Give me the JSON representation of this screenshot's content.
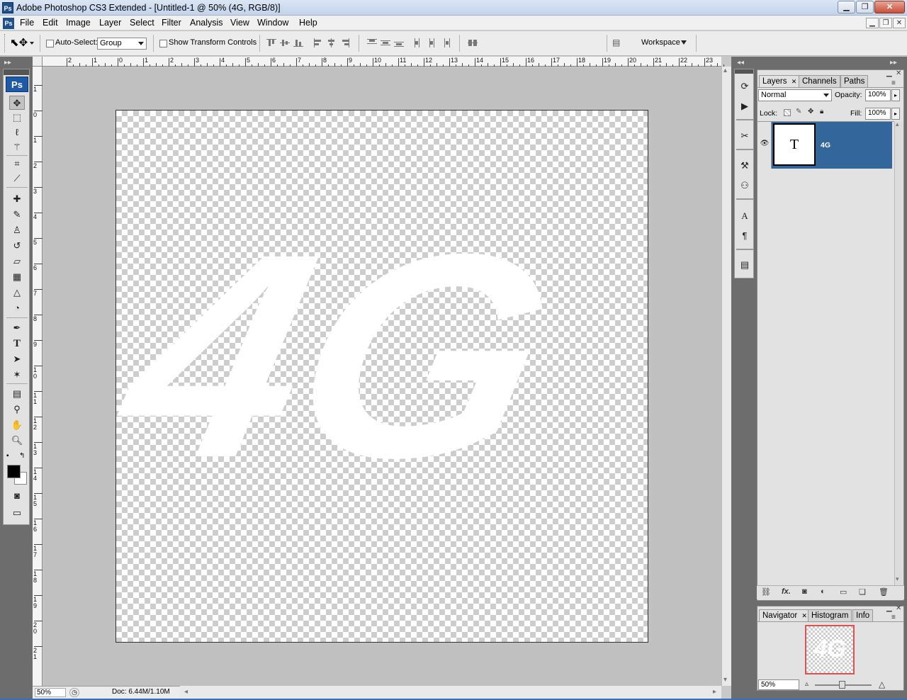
{
  "window": {
    "title": "Adobe Photoshop CS3 Extended - [Untitled-1 @ 50% (4G, RGB/8)]",
    "app_icon": "Ps",
    "controls": [
      "minimize-icon",
      "restore-icon",
      "close-icon"
    ]
  },
  "menu": {
    "items": [
      "File",
      "Edit",
      "Image",
      "Layer",
      "Select",
      "Filter",
      "Analysis",
      "View",
      "Window",
      "Help"
    ]
  },
  "options_bar": {
    "auto_select_label": "Auto-Select:",
    "auto_select_checked": false,
    "auto_select_value": "Group",
    "show_transform_label": "Show Transform Controls",
    "show_transform_checked": false,
    "workspace_label": "Workspace"
  },
  "toolbox": {
    "logo": "Ps",
    "tools": [
      "move-tool-icon",
      "marquee-tool-icon",
      "lasso-tool-icon",
      "magic-wand-icon",
      "crop-tool-icon",
      "slice-tool-icon",
      "healing-brush-icon",
      "brush-tool-icon",
      "clone-stamp-icon",
      "history-brush-icon",
      "eraser-tool-icon",
      "gradient-tool-icon",
      "blur-tool-icon",
      "dodge-tool-icon",
      "pen-tool-icon",
      "type-tool-icon",
      "path-selection-icon",
      "custom-shape-icon",
      "notes-tool-icon",
      "eyedropper-icon",
      "hand-tool-icon",
      "zoom-tool-icon"
    ],
    "foreground_color": "#000000",
    "background_color": "#ffffff"
  },
  "rulers": {
    "horizontal": [
      "2",
      "1",
      "0",
      "1",
      "2",
      "3",
      "4",
      "5",
      "6",
      "7",
      "8",
      "9",
      "10",
      "11",
      "12",
      "13",
      "14",
      "15",
      "16",
      "17",
      "18",
      "19",
      "20",
      "21",
      "22",
      "23"
    ],
    "vertical": [
      "1",
      "0",
      "1",
      "2",
      "3",
      "4",
      "5",
      "6",
      "7",
      "8",
      "9",
      "1 0",
      "1 1",
      "1 2",
      "1 3",
      "1 4",
      "1 5",
      "1 6",
      "1 7",
      "1 8",
      "1 9",
      "2 0",
      "2 1"
    ]
  },
  "canvas": {
    "text_layer_content": "4G",
    "text_color": "#ffffff"
  },
  "status": {
    "zoom": "50%",
    "doc_info": "Doc: 6.44M/1.10M"
  },
  "layers_panel": {
    "tabs": [
      "Layers",
      "Channels",
      "Paths"
    ],
    "blend_mode": "Normal",
    "opacity_label": "Opacity:",
    "opacity_value": "100%",
    "lock_label": "Lock:",
    "fill_label": "Fill:",
    "fill_value": "100%",
    "layers": [
      {
        "name": "4G",
        "thumb": "T",
        "visible": true,
        "selected": true
      }
    ],
    "selected_color": "#33669a"
  },
  "navigator_panel": {
    "tabs": [
      "Navigator",
      "Histogram",
      "Info"
    ],
    "zoom_value": "50%",
    "view_box_color": "#e05050"
  }
}
